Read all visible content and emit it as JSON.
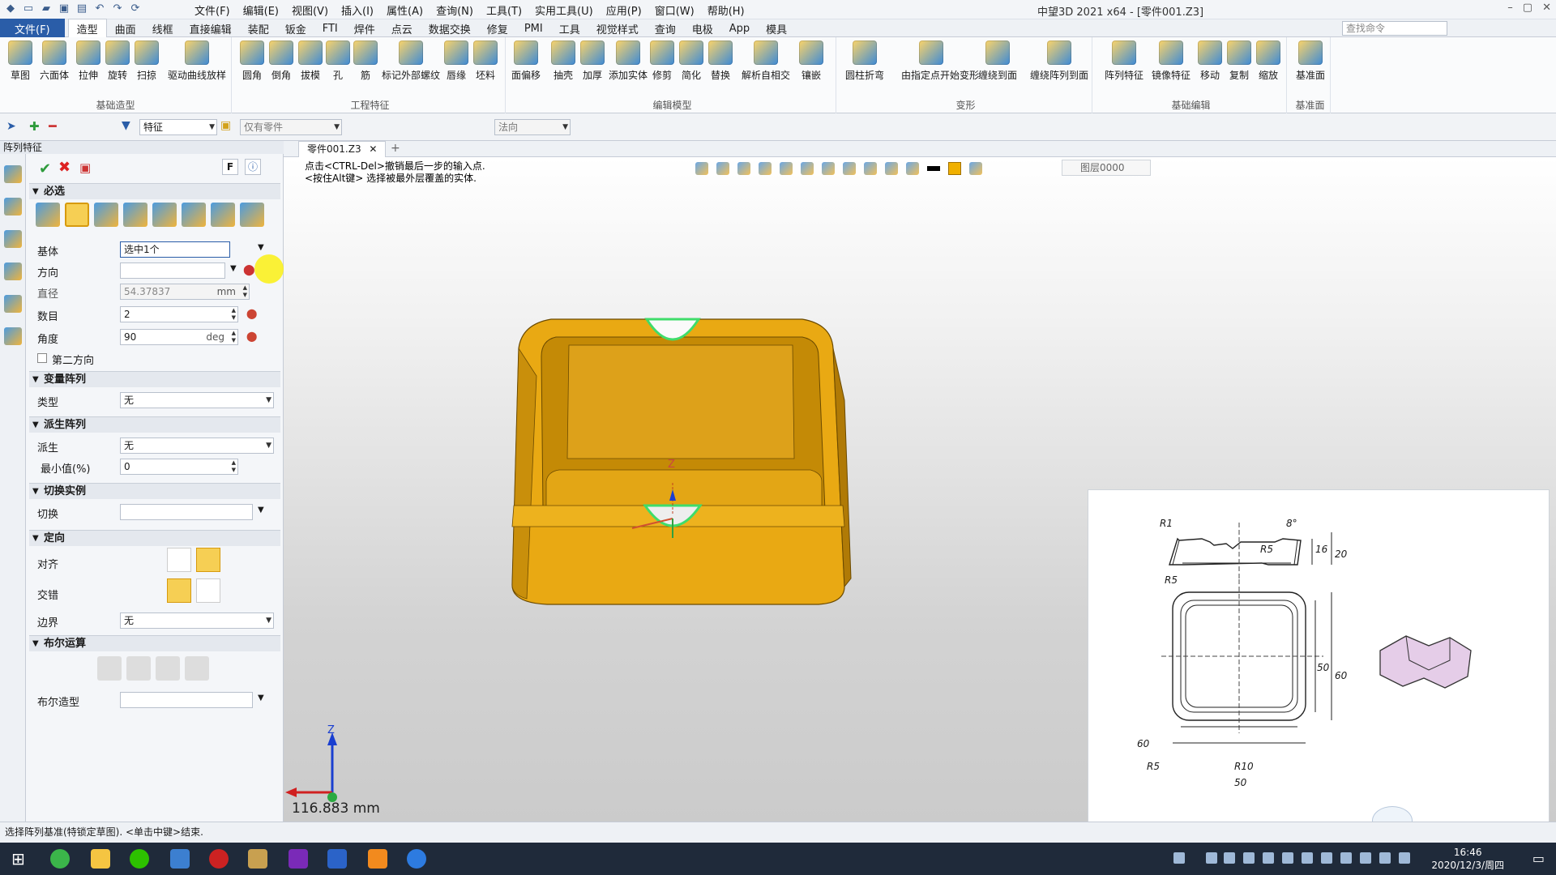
{
  "title_bar": {
    "menus": [
      "文件(F)",
      "编辑(E)",
      "视图(V)",
      "插入(I)",
      "属性(A)",
      "查询(N)",
      "工具(T)",
      "实用工具(U)",
      "应用(P)",
      "窗口(W)",
      "帮助(H)"
    ],
    "app_title": "中望3D 2021 x64 - [零件001.Z3]"
  },
  "ribbon_tabs": [
    "文件(F)",
    "造型",
    "曲面",
    "线框",
    "直接编辑",
    "装配",
    "钣金",
    "FTI",
    "焊件",
    "点云",
    "数据交换",
    "修复",
    "PMI",
    "工具",
    "视觉样式",
    "查询",
    "电极",
    "App",
    "模具"
  ],
  "active_tab": "造型",
  "command_search_placeholder": "查找命令",
  "ribbon_groups": [
    {
      "label": "基础造型",
      "buttons": [
        "草图",
        "六面体",
        "拉伸",
        "旋转",
        "扫掠",
        "驱动曲线放样"
      ]
    },
    {
      "label": "工程特征",
      "buttons": [
        "圆角",
        "倒角",
        "拔模",
        "孔",
        "筋",
        "标记外部螺纹",
        "唇缘",
        "坯料"
      ]
    },
    {
      "label": "编辑模型",
      "buttons": [
        "面偏移",
        "抽壳",
        "加厚",
        "添加实体",
        "修剪",
        "简化",
        "替换",
        "解析自相交",
        "镶嵌"
      ]
    },
    {
      "label": "变形",
      "buttons": [
        "圆柱折弯",
        "由指定点开始变形",
        "缠绕到面",
        "缠绕阵列到面"
      ]
    },
    {
      "label": "基础编辑",
      "buttons": [
        "阵列特征",
        "镜像特征",
        "移动",
        "复制",
        "缩放"
      ]
    },
    {
      "label": "基准面",
      "buttons": [
        "基准面"
      ]
    }
  ],
  "toolbar2": {
    "filter": "特征",
    "scope": "仅有零件",
    "direction": "法向"
  },
  "panel": {
    "title": "阵列特征",
    "sections": {
      "required": "必选",
      "variable": "变量阵列",
      "derived": "派生阵列",
      "toggle": "切换实例",
      "orient": "定向",
      "boolean": "布尔运算"
    },
    "fields": {
      "base_label": "基体",
      "base_value": "选中1个",
      "direction_label": "方向",
      "direction_value": "",
      "diameter_label": "直径",
      "diameter_value": "54.37837",
      "diameter_unit": "mm",
      "count_label": "数目",
      "count_value": "2",
      "angle_label": "角度",
      "angle_value": "90",
      "angle_unit": "deg",
      "second_dir": "第二方向",
      "type_label": "类型",
      "type_value": "无",
      "derive_label": "派生",
      "derive_value": "无",
      "min_label": "最小值(%)",
      "min_value": "0",
      "toggle_label": "切换",
      "align_label": "对齐",
      "stagger_label": "交错",
      "border_label": "边界",
      "border_value": "无",
      "bool_shape_label": "布尔造型"
    },
    "top_buttons": [
      "F"
    ]
  },
  "viewport": {
    "doc_tab": "零件001.Z3",
    "hint_line1": "点击<CTRL-Del>撤销最后一步的输入点.",
    "hint_line2": "<按住Alt键> 选择被最外层覆盖的实体.",
    "layer": "图层0000",
    "measure": "116.883 mm",
    "axis_z": "Z"
  },
  "drawing": {
    "labels": [
      "R1",
      "8°",
      "R5",
      "16",
      "20",
      "R5",
      "50",
      "60",
      "R5",
      "R10",
      "50",
      "60"
    ]
  },
  "status": "选择阵列基准(特锁定草图). <单击中键>结束.",
  "clock": {
    "time": "16:46",
    "date": "2020/12/3/周四"
  },
  "colors": {
    "accent": "#2a5da8",
    "part": "#e9a913",
    "part_dark": "#b07a06"
  }
}
